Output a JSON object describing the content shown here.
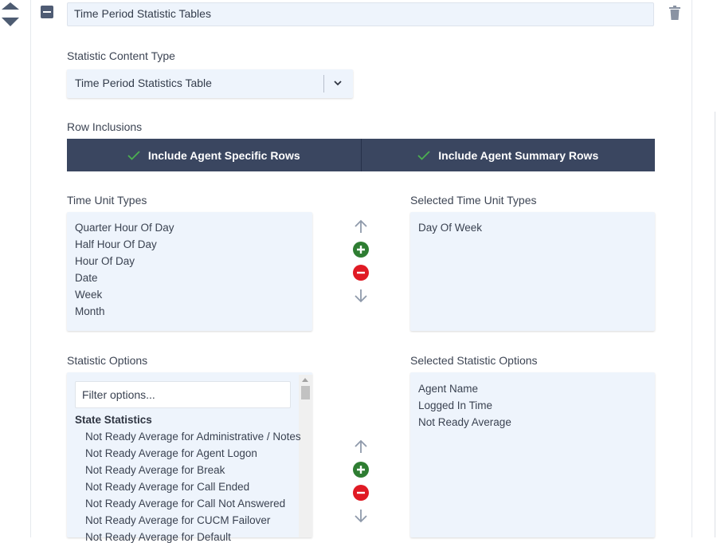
{
  "header": {
    "title_value": "Time Period Statistic Tables"
  },
  "content_type": {
    "label": "Statistic Content Type",
    "selected": "Time Period Statistics Table"
  },
  "row_inclusions": {
    "label": "Row Inclusions",
    "options": [
      {
        "label": "Include Agent Specific Rows",
        "checked": true
      },
      {
        "label": "Include Agent Summary Rows",
        "checked": true
      }
    ]
  },
  "time_units": {
    "available_label": "Time Unit Types",
    "selected_label": "Selected Time Unit Types",
    "available": [
      "Quarter Hour Of Day",
      "Half Hour Of Day",
      "Hour Of Day",
      "Date",
      "Week",
      "Month"
    ],
    "selected": [
      "Day Of Week"
    ]
  },
  "statistic_options": {
    "available_label": "Statistic Options",
    "selected_label": "Selected Statistic Options",
    "filter_placeholder": "Filter options...",
    "group": "State Statistics",
    "available": [
      "Not Ready Average for Administrative / Notes",
      "Not Ready Average for Agent Logon",
      "Not Ready Average for Break",
      "Not Ready Average for Call Ended",
      "Not Ready Average for Call Not Answered",
      "Not Ready Average for CUCM Failover",
      "Not Ready Average for Default"
    ],
    "selected": [
      "Agent Name",
      "Logged In Time",
      "Not Ready Average"
    ]
  },
  "colors": {
    "toggle_bar": "#3a4660",
    "check": "#4caf50",
    "add": "#2e7d32",
    "remove": "#e01a24",
    "list_bg": "#eef4fc"
  },
  "icons": {
    "reorder": [
      "move-up-icon",
      "move-down-icon"
    ],
    "collapse": "minus-icon",
    "delete": "trash-icon",
    "dropdown": "chevron-down-icon",
    "controls": [
      "arrow-up-icon",
      "plus-circle-icon",
      "minus-circle-icon",
      "arrow-down-icon"
    ]
  }
}
